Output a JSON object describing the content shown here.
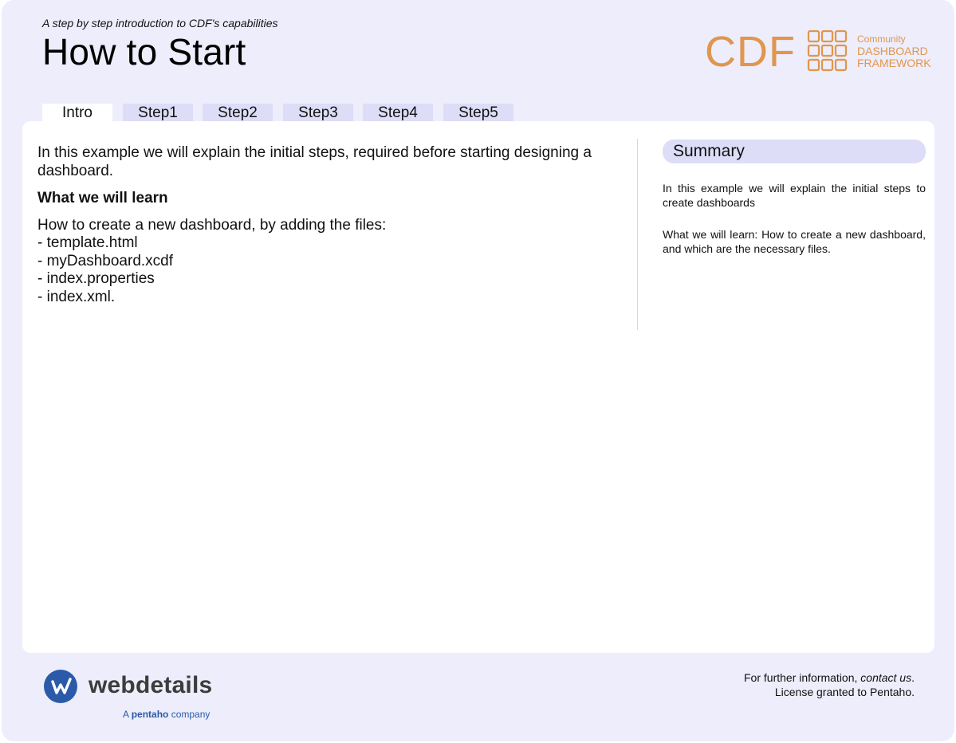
{
  "header": {
    "subtitle": "A step by step introduction to CDF's capabilities",
    "title": "How to Start"
  },
  "cdf_logo": {
    "acronym": "CDF",
    "line1": "Community",
    "line2": "DASHBOARD",
    "line3": "FRAMEWORK",
    "color": "#e0964c"
  },
  "tabs": [
    {
      "label": "Intro",
      "active": true
    },
    {
      "label": "Step1",
      "active": false
    },
    {
      "label": "Step2",
      "active": false
    },
    {
      "label": "Step3",
      "active": false
    },
    {
      "label": "Step4",
      "active": false
    },
    {
      "label": "Step5",
      "active": false
    }
  ],
  "main": {
    "intro": "In this example we will explain the initial steps, required before starting designing a dashboard.",
    "learn_heading": "What we will learn",
    "learn_text": "How to create a new dashboard, by adding the files:",
    "files": [
      "template.html",
      "myDashboard.xcdf",
      "index.properties",
      "index.xml."
    ]
  },
  "summary": {
    "heading": "Summary",
    "p1": "In this example we will explain the initial steps to create dashboards",
    "p2": "What we will learn: How to create a new dashboard, and which are the necessary files."
  },
  "brand": {
    "name": "webdetails",
    "sub_prefix": "A",
    "sub_brand": "pentaho",
    "sub_suffix": "company",
    "color": "#2b5aa8"
  },
  "footer": {
    "info_prefix": "For further information,",
    "contact_link": "contact us",
    "info_suffix": ".",
    "license": "License granted to Pentaho."
  }
}
